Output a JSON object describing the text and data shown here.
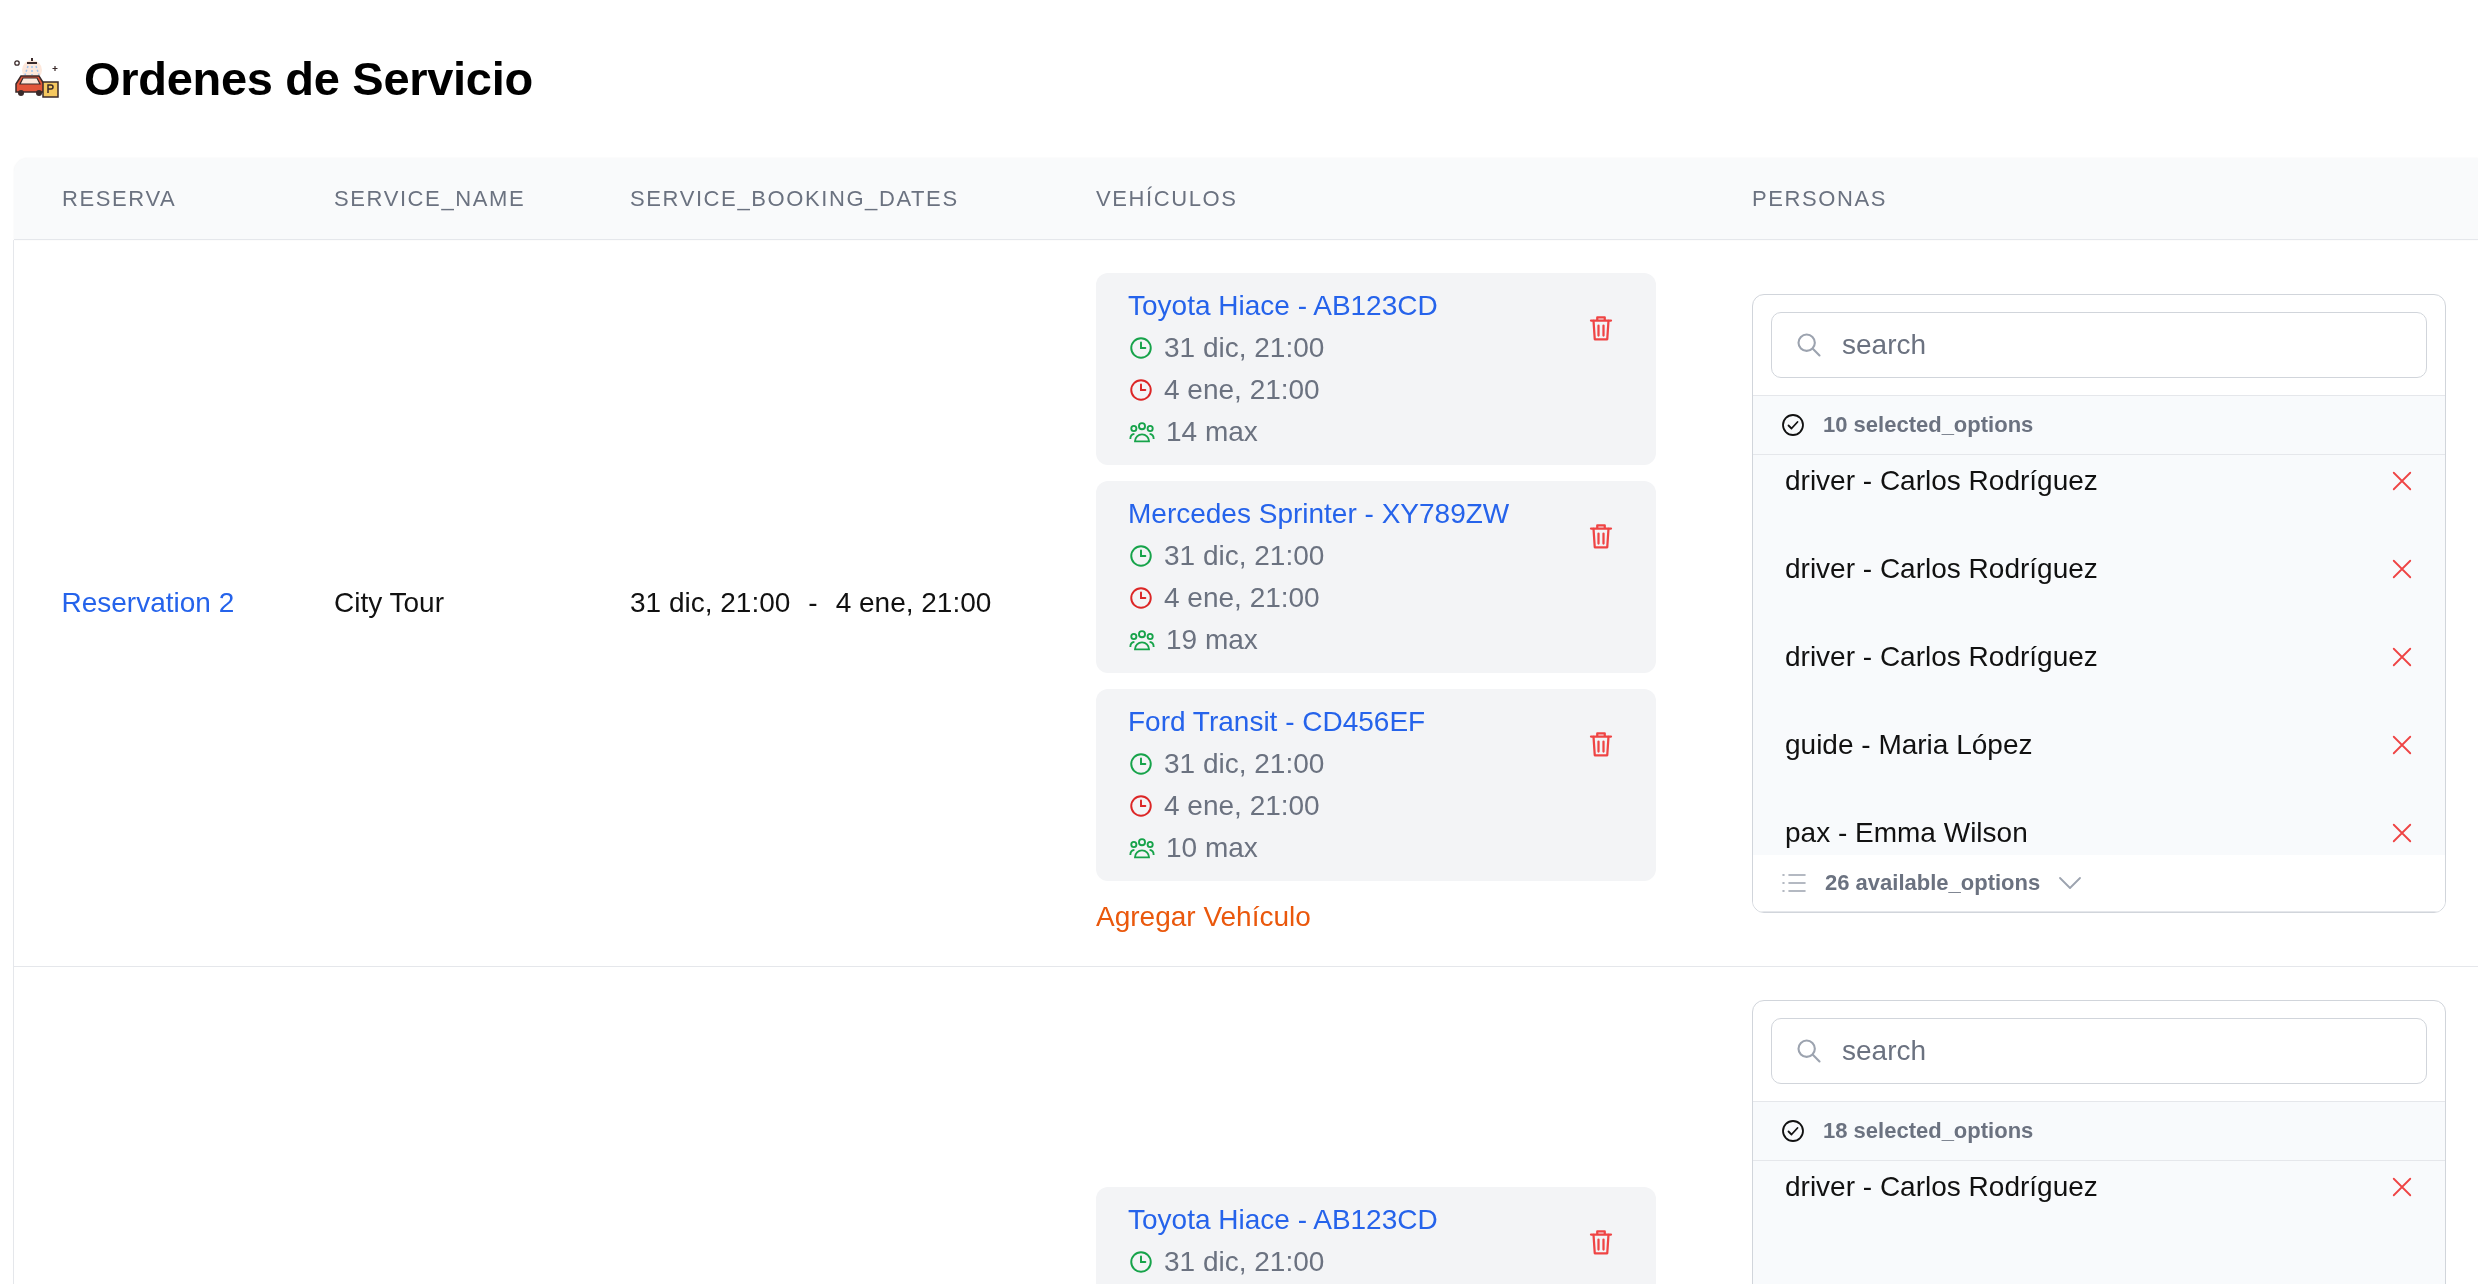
{
  "page": {
    "title": "Ordenes de Servicio"
  },
  "table": {
    "columns": [
      "RESERVA",
      "SERVICE_NAME",
      "SERVICE_BOOKING_DATES",
      "VEHÍCULOS",
      "PERSONAS"
    ],
    "rows": [
      {
        "reservation": "Reservation 2",
        "service_name": "City Tour",
        "dates": [
          "31 dic, 21:00",
          "-",
          "4 ene, 21:00"
        ],
        "vehicles": [
          {
            "name": "Toyota Hiace - AB123CD",
            "start": "31 dic, 21:00",
            "end": "4 ene, 21:00",
            "capacity": "14 max"
          },
          {
            "name": "Mercedes Sprinter - XY789ZW",
            "start": "31 dic, 21:00",
            "end": "4 ene, 21:00",
            "capacity": "19 max"
          },
          {
            "name": "Ford Transit - CD456EF",
            "start": "31 dic, 21:00",
            "end": "4 ene, 21:00",
            "capacity": "10 max"
          }
        ],
        "add_vehicle": "Agregar Vehículo",
        "personas": {
          "placeholder": "search",
          "selected_count": "10 selected_options",
          "selected": [
            "driver - Carlos Rodríguez",
            "driver - Carlos Rodríguez",
            "driver - Carlos Rodríguez",
            "guide - Maria López",
            "pax - Emma Wilson"
          ],
          "available_count": "26 available_options"
        }
      },
      {
        "vehicles": [
          {
            "name": "Toyota Hiace - AB123CD",
            "start": "31 dic, 21:00"
          }
        ],
        "personas": {
          "placeholder": "search",
          "selected_count": "18 selected_options",
          "selected": [
            "driver - Carlos Rodríguez"
          ]
        }
      }
    ]
  }
}
